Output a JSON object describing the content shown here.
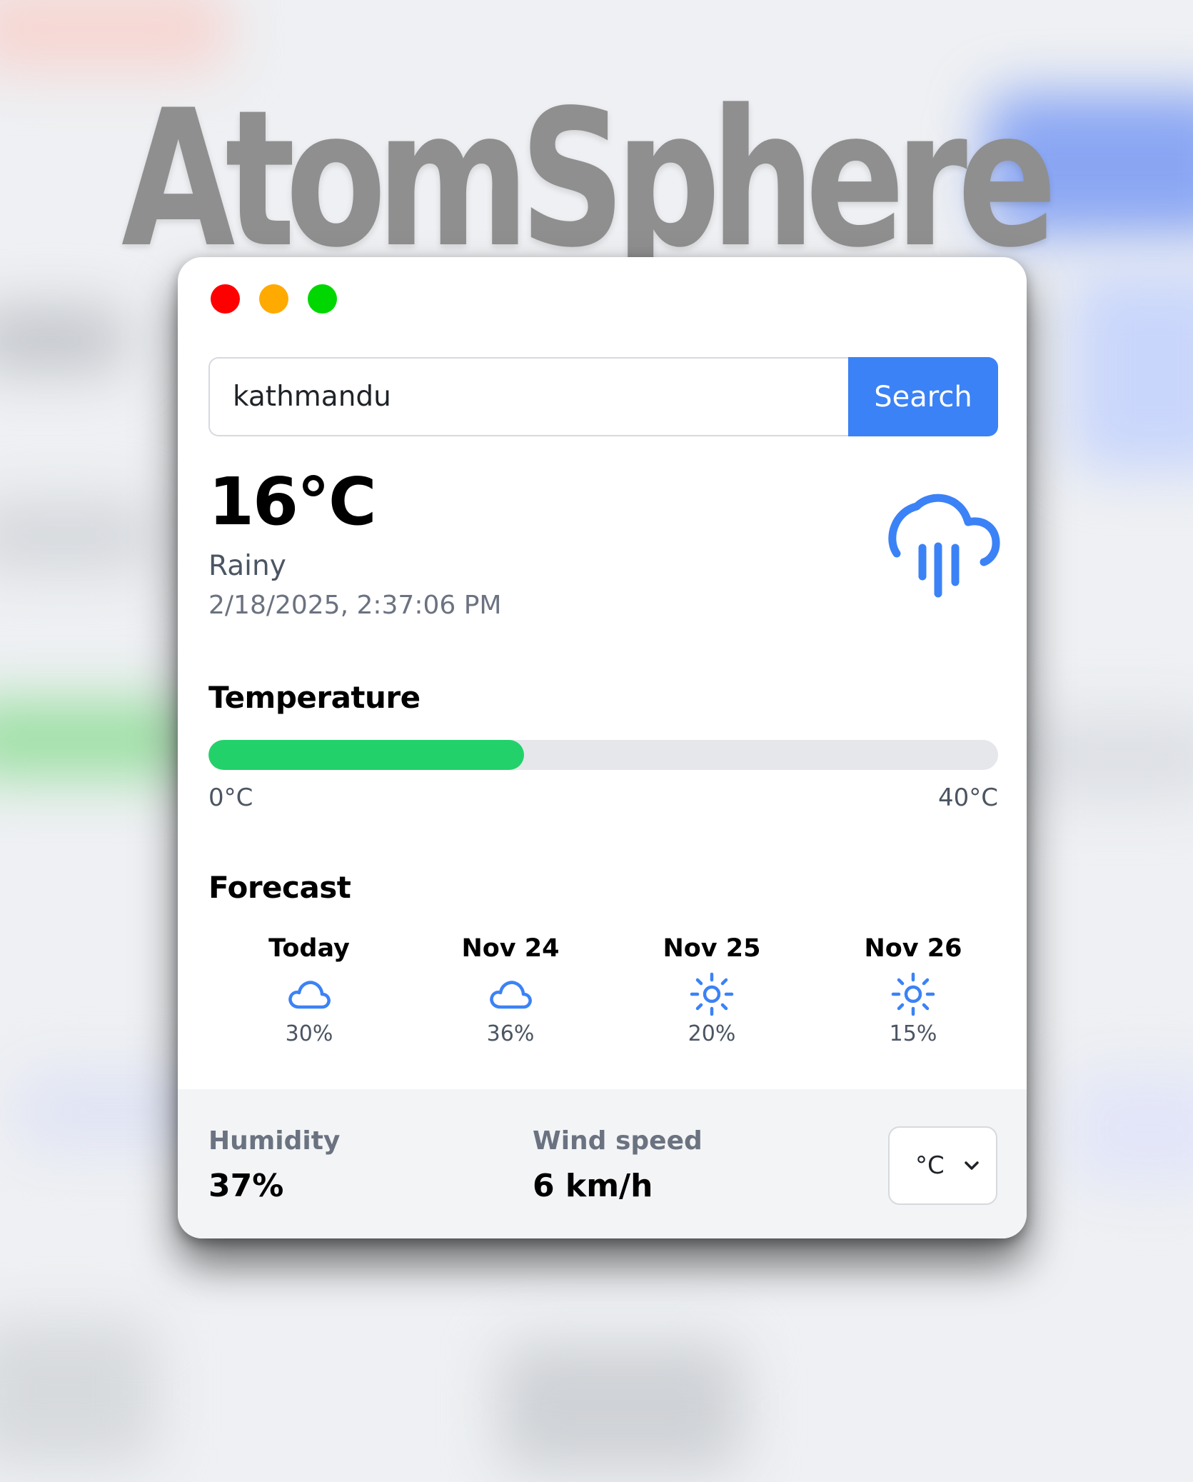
{
  "brand": "AtomSphere",
  "search": {
    "value": "kathmandu",
    "button_label": "Search"
  },
  "current": {
    "temperature": "16°C",
    "condition": "Rainy",
    "datetime": "2/18/2025, 2:37:06 PM",
    "icon": "cloud-rain-icon"
  },
  "temperature_section": {
    "title": "Temperature",
    "min_label": "0°C",
    "max_label": "40°C",
    "current_value_c": 16,
    "range_c": [
      0,
      40
    ],
    "fill_color": "#22d16a"
  },
  "forecast": {
    "title": "Forecast",
    "days": [
      {
        "label": "Today",
        "icon": "cloud-icon",
        "percent": "30%"
      },
      {
        "label": "Nov 24",
        "icon": "cloud-icon",
        "percent": "36%"
      },
      {
        "label": "Nov 25",
        "icon": "sun-icon",
        "percent": "20%"
      },
      {
        "label": "Nov 26",
        "icon": "sun-icon",
        "percent": "15%"
      }
    ]
  },
  "footer": {
    "humidity_label": "Humidity",
    "humidity_value": "37%",
    "wind_label": "Wind speed",
    "wind_value": "6 km/h",
    "unit_selected": "°C"
  },
  "colors": {
    "accent": "#3b82f6",
    "close_dot": "#ff0000",
    "minimize_dot": "#ffaa00",
    "maximize_dot": "#00d700"
  }
}
